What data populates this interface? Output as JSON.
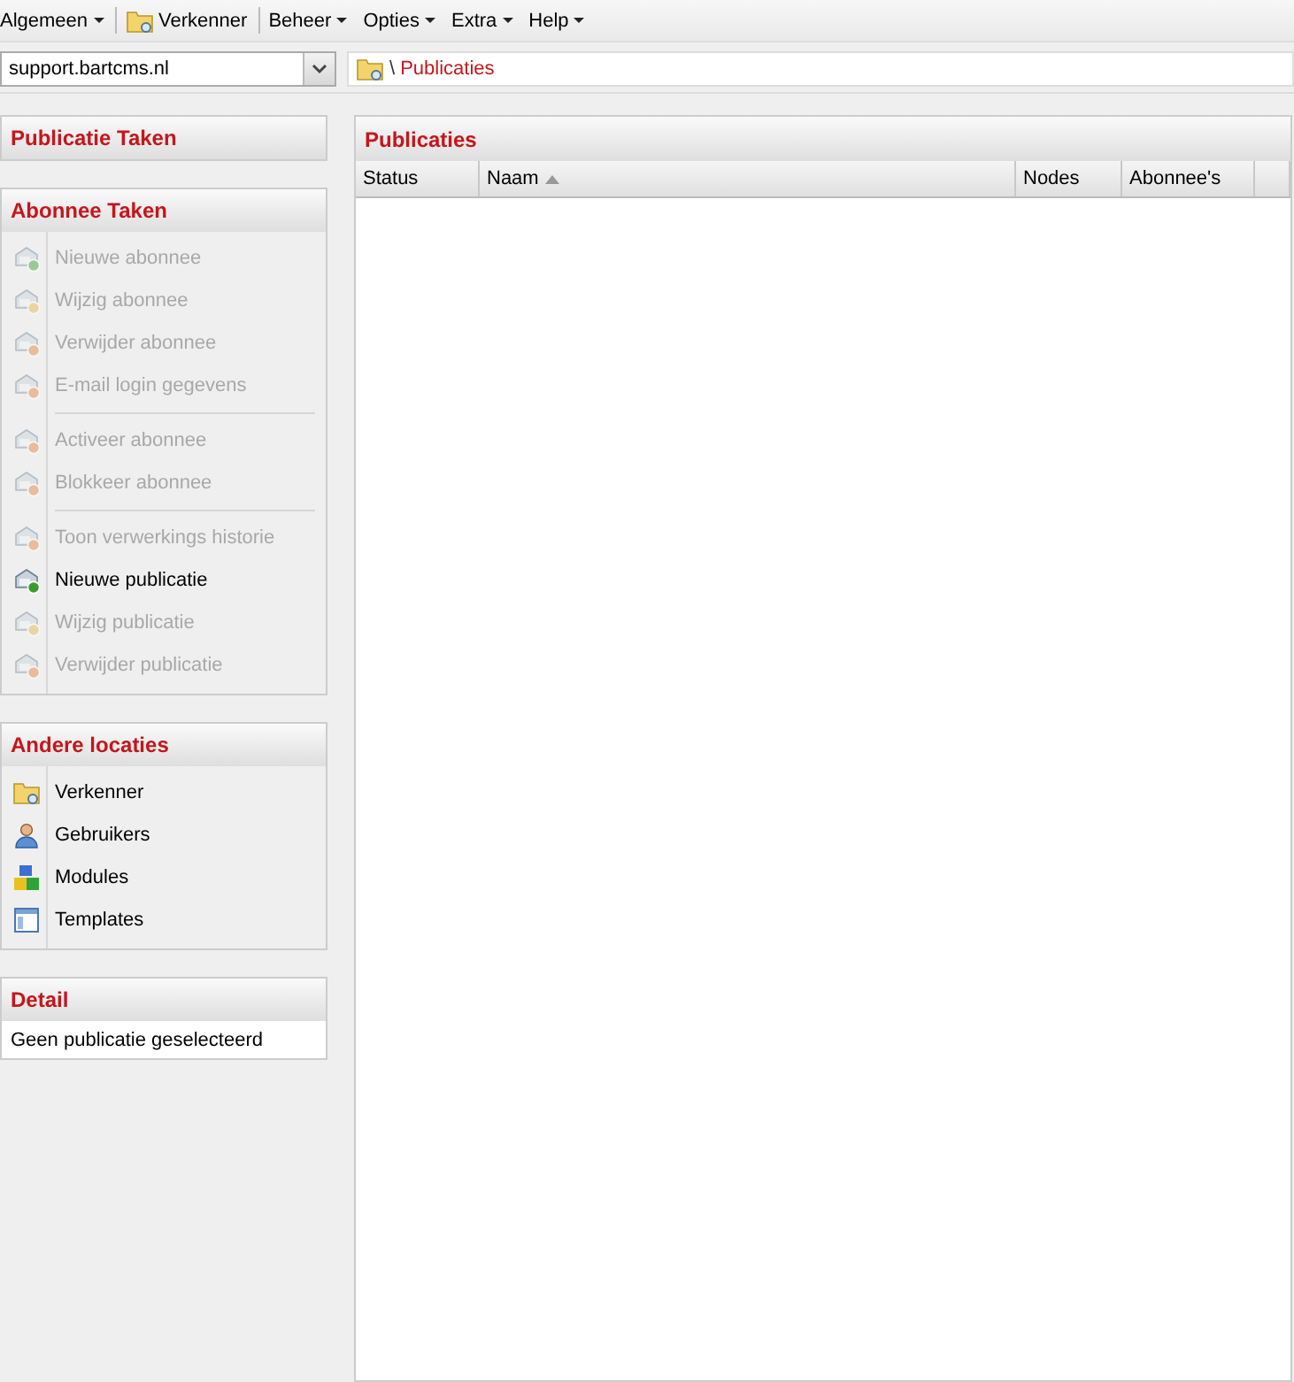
{
  "menu": [
    {
      "label": "Algemeen",
      "dropdown": true,
      "kind": "menu"
    },
    {
      "label": "Verkenner",
      "dropdown": false,
      "kind": "shortcut"
    },
    {
      "label": "Beheer",
      "dropdown": true,
      "kind": "menu"
    },
    {
      "label": "Opties",
      "dropdown": true,
      "kind": "menu"
    },
    {
      "label": "Extra",
      "dropdown": true,
      "kind": "menu"
    },
    {
      "label": "Help",
      "dropdown": true,
      "kind": "menu"
    }
  ],
  "site_select": {
    "value": "support.bartcms.nl"
  },
  "breadcrumb": {
    "separator": "\\",
    "label": "Publicaties"
  },
  "publicatie_taken": {
    "title": "Publicatie Taken"
  },
  "abonnee_taken": {
    "title": "Abonnee Taken",
    "groups": [
      [
        {
          "label": "Nieuwe abonnee",
          "kind": "add",
          "disabled": true
        },
        {
          "label": "Wijzig abonnee",
          "kind": "edit",
          "disabled": true
        },
        {
          "label": "Verwijder abonnee",
          "kind": "remove",
          "disabled": true
        },
        {
          "label": "E-mail login gegevens",
          "kind": "remove",
          "disabled": true
        }
      ],
      [
        {
          "label": "Activeer abonnee",
          "kind": "remove",
          "disabled": true
        },
        {
          "label": "Blokkeer abonnee",
          "kind": "remove",
          "disabled": true
        }
      ],
      [
        {
          "label": "Toon verwerkings historie",
          "kind": "remove",
          "disabled": true
        },
        {
          "label": "Nieuwe publicatie",
          "kind": "add",
          "disabled": false
        },
        {
          "label": "Wijzig publicatie",
          "kind": "edit",
          "disabled": true
        },
        {
          "label": "Verwijder publicatie",
          "kind": "remove",
          "disabled": true
        }
      ]
    ]
  },
  "andere_locaties": {
    "title": "Andere locaties",
    "items": [
      {
        "label": "Verkenner"
      },
      {
        "label": "Gebruikers"
      },
      {
        "label": "Modules"
      },
      {
        "label": "Templates"
      }
    ]
  },
  "detail": {
    "title": "Detail",
    "text": "Geen publicatie geselecteerd"
  },
  "publicaties": {
    "title": "Publicaties",
    "columns": [
      {
        "label": "Status",
        "sorted": false
      },
      {
        "label": "Naam",
        "sorted": true
      },
      {
        "label": "Nodes",
        "sorted": false
      },
      {
        "label": "Abonnee's",
        "sorted": false
      }
    ]
  }
}
